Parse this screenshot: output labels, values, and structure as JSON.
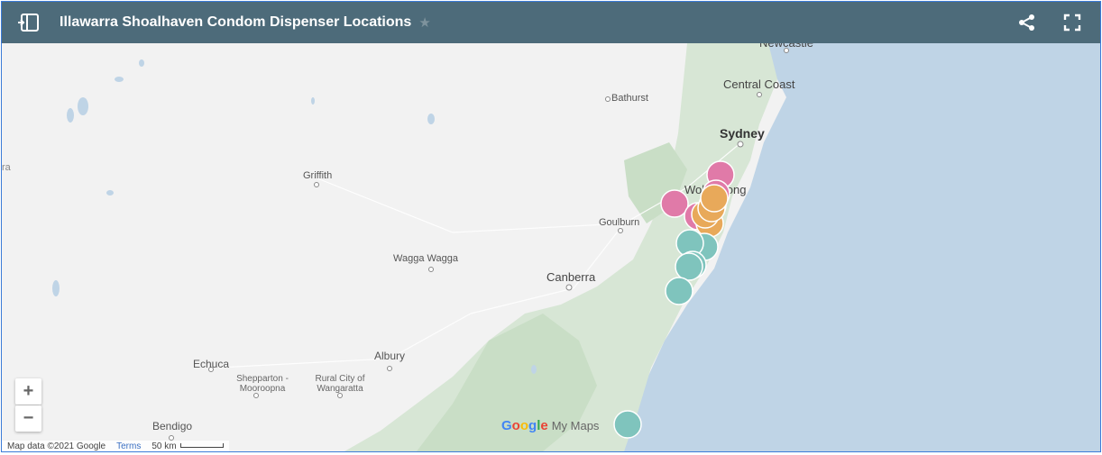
{
  "header": {
    "title": "Illawarra Shoalhaven Condom Dispenser Locations",
    "star": "★"
  },
  "map": {
    "places": [
      {
        "name": "Newcastle",
        "style": "big"
      },
      {
        "name": "Central Coast",
        "style": "big"
      },
      {
        "name": "Bathurst",
        "style": "normal"
      },
      {
        "name": "Sydney",
        "style": "bold"
      },
      {
        "name": "Wollongong",
        "style": "big"
      },
      {
        "name": "Griffith",
        "style": "normal"
      },
      {
        "name": "Goulburn",
        "style": "normal"
      },
      {
        "name": "Wagga Wagga",
        "style": "normal"
      },
      {
        "name": "Canberra",
        "style": "big"
      },
      {
        "name": "Albury",
        "style": "normal"
      },
      {
        "name": "Echuca",
        "style": "normal"
      },
      {
        "name": "Shepparton - Mooroopna",
        "style": "small"
      },
      {
        "name": "Rural City of Wangaratta",
        "style": "small"
      },
      {
        "name": "Bendigo",
        "style": "normal"
      },
      {
        "name": "ra",
        "style": "faint"
      }
    ],
    "marker_colors": {
      "pink": "#e07aa8",
      "orange": "#e8a95a",
      "teal": "#7fc4bd"
    },
    "zoom_in_label": "+",
    "zoom_out_label": "−",
    "attribution": "Map data ©2021 Google",
    "terms": "Terms",
    "scale": "50 km",
    "brand": {
      "google": [
        "G",
        "o",
        "o",
        "g",
        "l",
        "e"
      ],
      "product": "My Maps"
    }
  }
}
